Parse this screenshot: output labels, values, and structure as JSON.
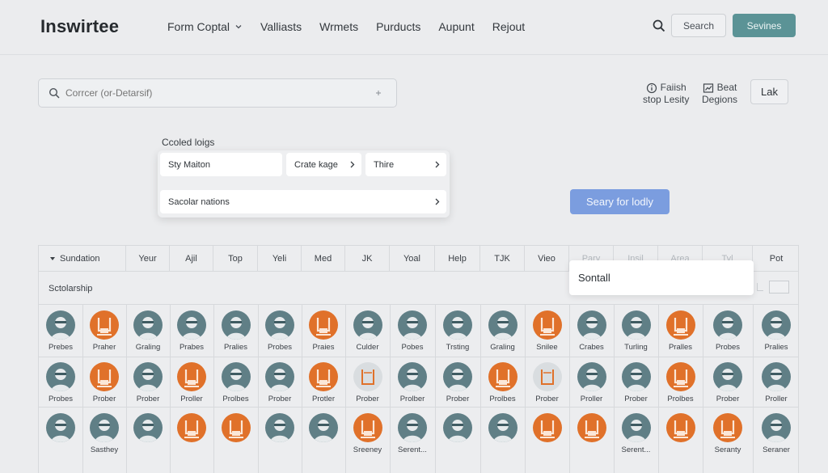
{
  "app": {
    "title": "Inswirtee"
  },
  "nav": {
    "items": [
      {
        "label": "Form Coptal",
        "has_chevron": true
      },
      {
        "label": "Valliasts"
      },
      {
        "label": "Wrmets"
      },
      {
        "label": "Purducts"
      },
      {
        "label": "Aupunt"
      },
      {
        "label": "Rejout"
      }
    ]
  },
  "header": {
    "search_button": "Search",
    "primary_button": "Sevines",
    "primary_color": "#5b9396"
  },
  "search": {
    "placeholder": "Corrcer (or-Detarsif)"
  },
  "utilities": [
    {
      "icon": "info-icon",
      "line1": "Faiish",
      "line2": "stop Lesity"
    },
    {
      "icon": "chart-icon",
      "line1": "Beat",
      "line2": "Degions"
    }
  ],
  "lak_button": "Lak",
  "options_panel": {
    "title": "Ccoled loigs",
    "items": [
      {
        "label": "Sty Maiton",
        "arrow": false
      },
      {
        "label": "Crate kage",
        "arrow": true
      },
      {
        "label": "Thire",
        "arrow": true
      },
      {
        "label": "Sacolar nations",
        "arrow": true
      }
    ]
  },
  "query_button": {
    "label": "Seary for lodly",
    "color": "#7b9ddf"
  },
  "table": {
    "headers": [
      "Sundation",
      "Yeur",
      "Ajil",
      "Top",
      "Yeli",
      "Med",
      "JK",
      "Yoal",
      "Help",
      "TJK",
      "Vieo",
      "Pary",
      "Insil",
      "Area",
      "Tyl",
      "Pot"
    ],
    "subrow": "Sctolarship",
    "rows": [
      [
        {
          "label": "Prebes",
          "tone": "teal"
        },
        {
          "label": "Praher",
          "tone": "orange"
        },
        {
          "label": "Graling",
          "tone": "teal"
        },
        {
          "label": "Prabes",
          "tone": "teal"
        },
        {
          "label": "Pralies",
          "tone": "teal"
        },
        {
          "label": "Probes",
          "tone": "teal"
        },
        {
          "label": "Praies",
          "tone": "orange"
        },
        {
          "label": "Culder",
          "tone": "teal"
        },
        {
          "label": "Pobes",
          "tone": "teal"
        },
        {
          "label": "Trsting",
          "tone": "teal"
        },
        {
          "label": "Graling",
          "tone": "teal"
        },
        {
          "label": "Snilee",
          "tone": "orange"
        },
        {
          "label": "Crabes",
          "tone": "teal"
        },
        {
          "label": "Turling",
          "tone": "teal"
        },
        {
          "label": "Pralles",
          "tone": "orange"
        },
        {
          "label": "Probes",
          "tone": "teal"
        },
        {
          "label": "Pralies",
          "tone": "teal"
        }
      ],
      [
        {
          "label": "Probes",
          "tone": "teal"
        },
        {
          "label": "Prober",
          "tone": "orange"
        },
        {
          "label": "Prober",
          "tone": "teal"
        },
        {
          "label": "Proller",
          "tone": "orange"
        },
        {
          "label": "Prolbes",
          "tone": "teal"
        },
        {
          "label": "Prober",
          "tone": "teal"
        },
        {
          "label": "Protler",
          "tone": "orange"
        },
        {
          "label": "Prober",
          "tone": "light"
        },
        {
          "label": "Prolber",
          "tone": "teal"
        },
        {
          "label": "Prober",
          "tone": "teal"
        },
        {
          "label": "Prolbes",
          "tone": "orange"
        },
        {
          "label": "Prober",
          "tone": "light"
        },
        {
          "label": "Proller",
          "tone": "teal"
        },
        {
          "label": "Prober",
          "tone": "teal"
        },
        {
          "label": "Prolbes",
          "tone": "orange"
        },
        {
          "label": "Prober",
          "tone": "teal"
        },
        {
          "label": "Proller",
          "tone": "teal"
        }
      ],
      [
        {
          "label": "",
          "tone": "teal"
        },
        {
          "label": "Sasthey",
          "tone": "teal"
        },
        {
          "label": "",
          "tone": "teal"
        },
        {
          "label": "",
          "tone": "orange"
        },
        {
          "label": "",
          "tone": "orange"
        },
        {
          "label": "",
          "tone": "teal"
        },
        {
          "label": "",
          "tone": "teal"
        },
        {
          "label": "Sreeney",
          "tone": "orange"
        },
        {
          "label": "Serent...",
          "tone": "teal"
        },
        {
          "label": "",
          "tone": "teal"
        },
        {
          "label": "",
          "tone": "teal"
        },
        {
          "label": "",
          "tone": "orange"
        },
        {
          "label": "",
          "tone": "orange"
        },
        {
          "label": "Serent...",
          "tone": "teal"
        },
        {
          "label": "",
          "tone": "orange"
        },
        {
          "label": "Seranty",
          "tone": "orange"
        },
        {
          "label": "Seraner",
          "tone": "teal"
        }
      ]
    ]
  },
  "popover": {
    "text": "Sontall"
  }
}
